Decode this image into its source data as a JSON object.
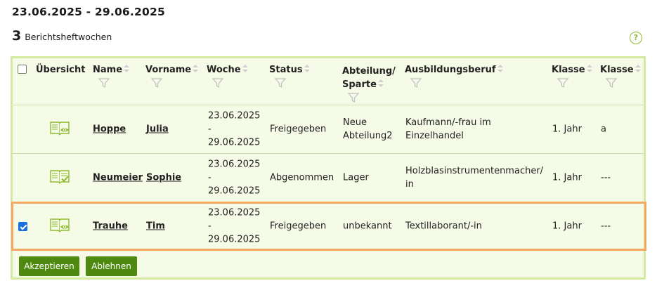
{
  "header": {
    "date_range": "23.06.2025 - 29.06.2025",
    "count": "3",
    "count_label": "Berichtsheftwochen",
    "help_label": "?"
  },
  "table": {
    "columns": {
      "uebersicht": "Übersicht",
      "name": "Name",
      "vorname": "Vorname",
      "woche": "Woche",
      "status": "Status",
      "abteilung_line1": "Abteilung/",
      "abteilung_line2": "Sparte",
      "beruf": "Ausbildungsberuf",
      "klasse1": "Klasse",
      "klasse2": "Klasse"
    },
    "rows": [
      {
        "checked": false,
        "icon": "report-view-icon",
        "name": "Hoppe",
        "vorname": "Julia",
        "woche_line1": "23.06.2025",
        "woche_line2": "-",
        "woche_line3": "29.06.2025",
        "status": "Freigegeben",
        "abteilung_line1": "Neue",
        "abteilung_line2": "Abteilung2",
        "beruf_line1": "Kaufmann/-frau im",
        "beruf_line2": "Einzelhandel",
        "klasse1": "1. Jahr",
        "klasse2": "a"
      },
      {
        "checked": false,
        "icon": "report-approved-icon",
        "name": "Neumeier",
        "vorname": "Sophie",
        "woche_line1": "23.06.2025",
        "woche_line2": "-",
        "woche_line3": "29.06.2025",
        "status": "Abgenommen",
        "abteilung_line1": "Lager",
        "abteilung_line2": "",
        "beruf_line1": "Holzblasinstrumentenmacher/",
        "beruf_line2": "in",
        "klasse1": "1. Jahr",
        "klasse2": "---"
      },
      {
        "checked": true,
        "icon": "report-view-icon",
        "name": "Trauhe",
        "vorname": "Tim",
        "woche_line1": "23.06.2025",
        "woche_line2": "-",
        "woche_line3": "29.06.2025",
        "status": "Freigegeben",
        "abteilung_line1": "unbekannt",
        "abteilung_line2": "",
        "beruf_line1": "Textillaborant/-in",
        "beruf_line2": "",
        "klasse1": "1. Jahr",
        "klasse2": "---"
      }
    ]
  },
  "actions": {
    "accept_label": "Akzeptieren",
    "reject_label": "Ablehnen"
  },
  "colors": {
    "accent_green": "#4f8a10",
    "panel_border": "#d4eaa0",
    "panel_bg": "#f6fbe8",
    "selected_border": "#f5a862",
    "icon_green": "#8dbb2e"
  }
}
